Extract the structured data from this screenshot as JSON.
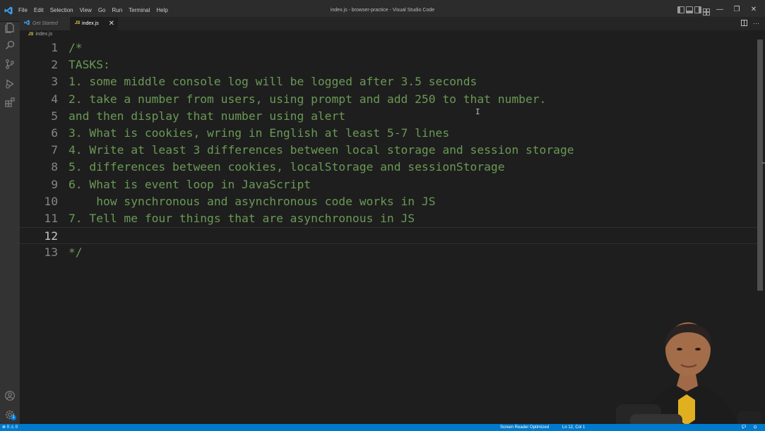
{
  "window": {
    "title": "index.js - browser-practice - Visual Studio Code",
    "menu": [
      "File",
      "Edit",
      "Selection",
      "View",
      "Go",
      "Run",
      "Terminal",
      "Help"
    ],
    "controls": {
      "minimize": "—",
      "restore": "❐",
      "close": "✕"
    }
  },
  "tabs": [
    {
      "label": "Get Started",
      "icon": "vscode-icon",
      "active": false
    },
    {
      "label": "index.js",
      "icon": "js-icon",
      "icon_text": "JS",
      "active": true,
      "close": "✕"
    }
  ],
  "tab_actions": {
    "split": "split-editor-icon",
    "more": "···"
  },
  "breadcrumb": {
    "icon_text": "JS",
    "file": "index.js"
  },
  "editor": {
    "current_line": 12,
    "lines": [
      {
        "n": "1",
        "text": "/*"
      },
      {
        "n": "2",
        "text": "TASKS:"
      },
      {
        "n": "3",
        "text": "1. some middle console log will be logged after 3.5 seconds"
      },
      {
        "n": "4",
        "text": "2. take a number from users, using prompt and add 250 to that number."
      },
      {
        "n": "5",
        "text": "and then display that number using alert"
      },
      {
        "n": "6",
        "text": "3. What is cookies, wring in English at least 5-7 lines"
      },
      {
        "n": "7",
        "text": "4. Write at least 3 differences between local storage and session storage"
      },
      {
        "n": "8",
        "text": "5. differences between cookies, localStorage and sessionStorage"
      },
      {
        "n": "9",
        "text": "6. What is event loop in JavaScript"
      },
      {
        "n": "10",
        "text": "    how synchronous and asynchronous code works in JS"
      },
      {
        "n": "11",
        "text": "7. Tell me four things that are asynchronous in JS"
      },
      {
        "n": "12",
        "text": ""
      },
      {
        "n": "13",
        "text": "*/"
      }
    ]
  },
  "activity_bar": [
    "explorer-icon",
    "search-icon",
    "source-control-icon",
    "run-debug-icon",
    "extensions-icon",
    "account-icon",
    "settings-gear-icon"
  ],
  "settings_badge": "1",
  "status_bar": {
    "problems": "⊗ 0 ⚠ 0",
    "screen_reader": "Screen Reader Optimized",
    "position": "Ln 12, Col 1"
  },
  "colors": {
    "editor_bg": "#1e1e1e",
    "comment": "#6a9955",
    "status_bar": "#007acc",
    "title_bar": "#2c2c2d",
    "activity_bar": "#333333"
  }
}
